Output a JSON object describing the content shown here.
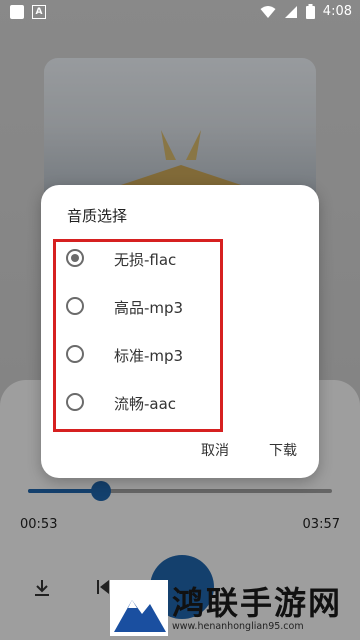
{
  "status_bar": {
    "time": "4:08",
    "a_icon_text": "A"
  },
  "player": {
    "elapsed": "00:53",
    "duration": "03:57",
    "progress_fraction": 0.24
  },
  "dialog": {
    "title": "音质选择",
    "options": [
      {
        "label": "无损-flac",
        "checked": true
      },
      {
        "label": "高品-mp3",
        "checked": false
      },
      {
        "label": "标准-mp3",
        "checked": false
      },
      {
        "label": "流畅-aac",
        "checked": false
      }
    ],
    "cancel_label": "取消",
    "download_label": "下载"
  },
  "watermark": {
    "title": "鸿联手游网",
    "url": "www.henanhonglian95.com"
  },
  "colors": {
    "accent": "#1f63a8",
    "highlight": "#d62020"
  }
}
